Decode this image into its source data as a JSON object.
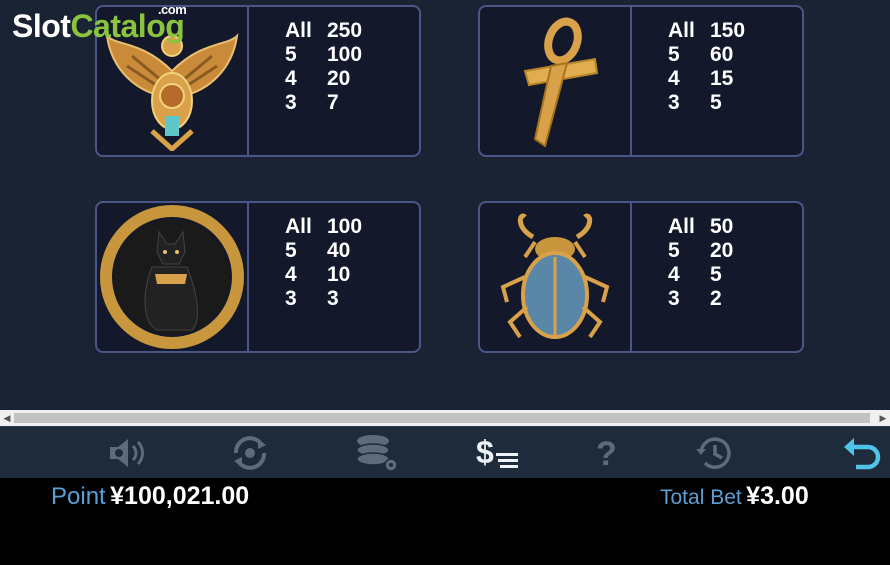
{
  "logo": {
    "part1": "Slot",
    "part2": "Catalog",
    "suffix": ".com"
  },
  "paytable": [
    {
      "symbol_icon": "winged-scarab-icon",
      "rows": [
        {
          "k": "All",
          "v": "250"
        },
        {
          "k": "5",
          "v": "100"
        },
        {
          "k": "4",
          "v": "20"
        },
        {
          "k": "3",
          "v": "7"
        }
      ]
    },
    {
      "symbol_icon": "ankh-icon",
      "rows": [
        {
          "k": "All",
          "v": "150"
        },
        {
          "k": "5",
          "v": "60"
        },
        {
          "k": "4",
          "v": "15"
        },
        {
          "k": "3",
          "v": "5"
        }
      ]
    },
    {
      "symbol_icon": "black-cat-icon",
      "rows": [
        {
          "k": "All",
          "v": "100"
        },
        {
          "k": "5",
          "v": "40"
        },
        {
          "k": "4",
          "v": "10"
        },
        {
          "k": "3",
          "v": "3"
        }
      ]
    },
    {
      "symbol_icon": "blue-scarab-icon",
      "rows": [
        {
          "k": "All",
          "v": "50"
        },
        {
          "k": "5",
          "v": "20"
        },
        {
          "k": "4",
          "v": "5"
        },
        {
          "k": "3",
          "v": "2"
        }
      ]
    }
  ],
  "toolbar": {
    "icons": [
      "sound-icon",
      "autoplay-icon",
      "chips-settings-icon",
      "paytable-icon",
      "help-icon",
      "history-icon",
      "back-icon"
    ],
    "active": "paytable-icon",
    "accent": "#4fc3e8"
  },
  "footer": {
    "point_label": "Point",
    "point_value": "¥100,021.00",
    "bet_label": "Total Bet",
    "bet_value": "¥3.00"
  },
  "colors": {
    "panel_bg": "#1a2333",
    "card_border": "#4a5688",
    "label_blue": "#5b9fd6"
  }
}
